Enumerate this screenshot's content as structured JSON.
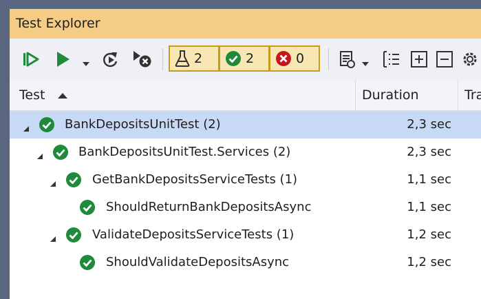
{
  "window": {
    "title": "Test Explorer"
  },
  "toolbar": {
    "run_all_icon": "run-all-icon",
    "run_icon": "run-icon",
    "rerun_failed_icon": "rerun-icon",
    "cancel_icon": "cancel-icon",
    "total_count": "2",
    "passed_count": "2",
    "failed_count": "0",
    "colors": {
      "passed": "#1f8a3a",
      "failed": "#c4161c",
      "counter_border": "#c69a1d",
      "counter_bg": "#f8e7b3",
      "title_bg": "#f5cc84",
      "selection": "#c7d9f5"
    }
  },
  "columns": {
    "test": "Test",
    "duration": "Duration",
    "traits": "Tra"
  },
  "tree": [
    {
      "name": "BankDepositsUnitTest (2)",
      "duration": "2,3 sec",
      "level": 0,
      "expanded": true,
      "status": "passed",
      "selected": true
    },
    {
      "name": "BankDepositsUnitTest.Services (2)",
      "duration": "2,3 sec",
      "level": 1,
      "expanded": true,
      "status": "passed",
      "selected": false
    },
    {
      "name": "GetBankDepositsServiceTests (1)",
      "duration": "1,1 sec",
      "level": 2,
      "expanded": true,
      "status": "passed",
      "selected": false
    },
    {
      "name": "ShouldReturnBankDepositsAsync",
      "duration": "1,1 sec",
      "level": 3,
      "expanded": false,
      "status": "passed",
      "selected": false
    },
    {
      "name": "ValidateDepositsServiceTests (1)",
      "duration": "1,2 sec",
      "level": 2,
      "expanded": true,
      "status": "passed",
      "selected": false
    },
    {
      "name": "ShouldValidateDepositsAsync",
      "duration": "1,2 sec",
      "level": 3,
      "expanded": false,
      "status": "passed",
      "selected": false
    }
  ]
}
